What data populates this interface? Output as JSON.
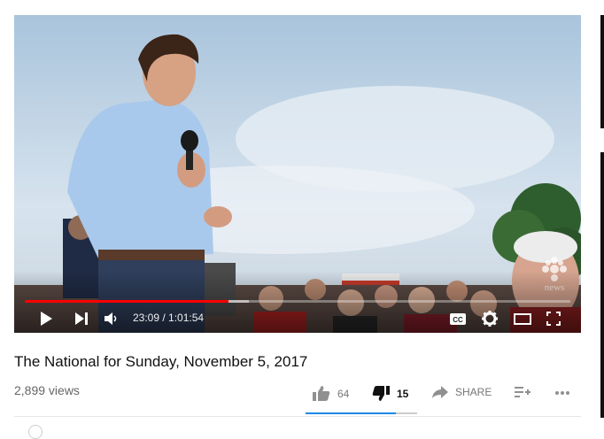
{
  "player": {
    "time_display": "23:09 / 1:01:54",
    "played_fraction": 0.374,
    "loaded_fraction": 0.41,
    "cc_label": "CC",
    "channel_logo_text": "news"
  },
  "video": {
    "title": "The National for Sunday, November 5, 2017",
    "views": "2,899 views"
  },
  "actions": {
    "like_count": "64",
    "dislike_count": "15",
    "share_label": "SHARE"
  },
  "sentiment": {
    "like_fraction": 0.81
  },
  "icons": {
    "play": "play-icon",
    "next": "skip-next-icon",
    "volume": "volume-icon",
    "captions": "captions-icon",
    "settings": "gear-icon",
    "theater": "theater-mode-icon",
    "fullscreen": "fullscreen-icon",
    "like": "thumbs-up-icon",
    "dislike": "thumbs-down-icon",
    "share": "share-arrow-icon",
    "add_to_playlist": "add-to-playlist-icon",
    "more": "more-horizontal-icon"
  },
  "colors": {
    "progress": "#ff0000",
    "like_bar": "#1e88e5"
  }
}
